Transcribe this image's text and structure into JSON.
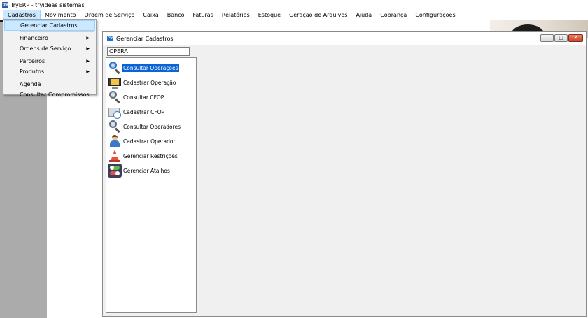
{
  "app": {
    "icon_text": "try",
    "title": "TryERP - tryideas sistemas"
  },
  "menubar": {
    "items": [
      "Cadastros",
      "Movimento",
      "Ordem de Serviço",
      "Caixa",
      "Banco",
      "Faturas",
      "Relatórios",
      "Estoque",
      "Geração de Arquivos",
      "Ajuda",
      "Cobrança",
      "Configurações"
    ],
    "active_index": 0
  },
  "dropdown": {
    "items": [
      {
        "label": "Gerenciar Cadastros",
        "submenu": false,
        "highlighted": true
      },
      {
        "label": "Financeiro",
        "submenu": true
      },
      {
        "label": "Ordens de Serviço",
        "submenu": true
      },
      {
        "label": "Parceiros",
        "submenu": true
      },
      {
        "label": "Produtos",
        "submenu": true
      },
      {
        "label": "Agenda",
        "submenu": false
      },
      {
        "label": "Consultar Compromissos",
        "submenu": false
      }
    ],
    "submenu_arrow": "▶"
  },
  "child_window": {
    "icon_text": "try",
    "title": "Gerenciar Cadastros",
    "buttons": {
      "minimize": "–",
      "maximize": "□",
      "close": "✕"
    },
    "search": {
      "value": "OPERA"
    },
    "list": [
      {
        "label": "Consultar Operações",
        "icon": "search-icon-blue",
        "selected": true
      },
      {
        "label": "Cadastrar Operação",
        "icon": "monitor-icon",
        "selected": false
      },
      {
        "label": "Consultar CFOP",
        "icon": "search-icon",
        "selected": false
      },
      {
        "label": "Cadastrar CFOP",
        "icon": "folder-icon",
        "selected": false
      },
      {
        "label": "Consultar Operadores",
        "icon": "search-icon",
        "selected": false
      },
      {
        "label": "Cadastrar Operador",
        "icon": "person-icon",
        "selected": false
      },
      {
        "label": "Gerenciar Restrições",
        "icon": "traffic-cone-icon",
        "selected": false
      },
      {
        "label": "Gerenciar Atalhos",
        "icon": "toggle-icon",
        "selected": false
      }
    ]
  },
  "colors": {
    "selection": "#0a64d6",
    "menu_highlight": "#cce8ff",
    "desktop_gray": "#ababab"
  }
}
